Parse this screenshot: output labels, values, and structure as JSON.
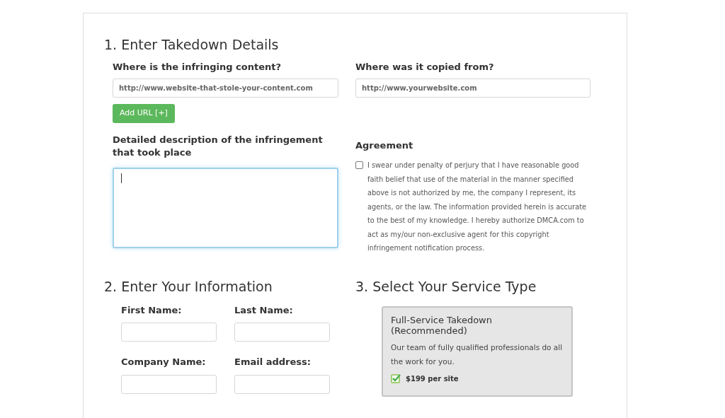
{
  "takedown": {
    "title": "1. Enter Takedown Details",
    "infringing": {
      "label": "Where is the infringing content?",
      "placeholder": "http://www.website-that-stole-your-content.com"
    },
    "source": {
      "label": "Where was it copied from?",
      "placeholder": "http://www.yourwebsite.com"
    },
    "add_url": "Add URL [+]",
    "description": {
      "label": "Detailed description of the infringement that took place",
      "focused": true
    },
    "agreement": {
      "label": "Agreement",
      "checked": false,
      "text": "I swear under penalty of perjury that I have reasonable good faith belief that use of the material in the manner specified above is not authorized by me, the company I represent, its agents, or the law. The information provided herein is accurate to the best of my knowledge. I hereby authorize DMCA.com to act as my/our non-exclusive agent for this copyright infringement notification process."
    }
  },
  "information": {
    "title": "2. Enter Your Information",
    "fields": [
      {
        "label": "First Name:"
      },
      {
        "label": "Last Name:"
      },
      {
        "label": "Company Name:"
      },
      {
        "label": "Email address:"
      }
    ]
  },
  "service": {
    "title": "3. Select Your Service Type",
    "options": [
      {
        "name": "Full-Service Takedown (Recommended)",
        "description": "Our team of fully qualified professionals do all the work for you.",
        "price": "$199 per site",
        "selected": true
      }
    ]
  }
}
